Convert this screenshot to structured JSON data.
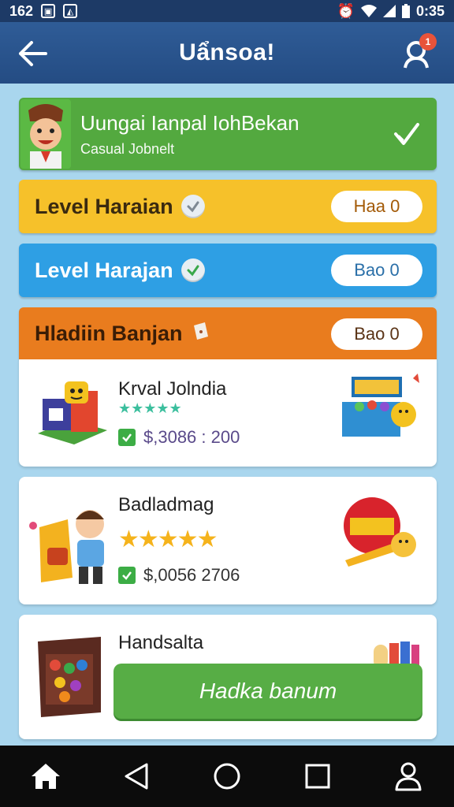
{
  "status_bar": {
    "time_left": "162",
    "time_right": "0:35"
  },
  "app_bar": {
    "title": "Uẩnsoa!",
    "notification_count": "1"
  },
  "banner_main": {
    "title": "Uungai Ianpal IohBekan",
    "subtitle": "Casual Jobnelt"
  },
  "levels": [
    {
      "label": "Level Haraian",
      "button": "Haa 0",
      "color": "#f6c12a"
    },
    {
      "label": "Level Harajan",
      "button": "Bao 0",
      "color": "#2e9fe4"
    },
    {
      "label": "Hladiin Banjan",
      "button": "Bao 0",
      "color": "#e97c1e"
    }
  ],
  "cards": [
    {
      "name": "Krval Jolndia",
      "price": "$,3086 : 200"
    },
    {
      "name": "Badladmag",
      "price": "$,0056 2706"
    },
    {
      "name": "Handsalta",
      "button": "Hadka banum"
    }
  ],
  "nav": {
    "icons": [
      "home-icon",
      "back-triangle-icon",
      "circle-home-icon",
      "square-recents-icon",
      "profile-icon"
    ]
  }
}
